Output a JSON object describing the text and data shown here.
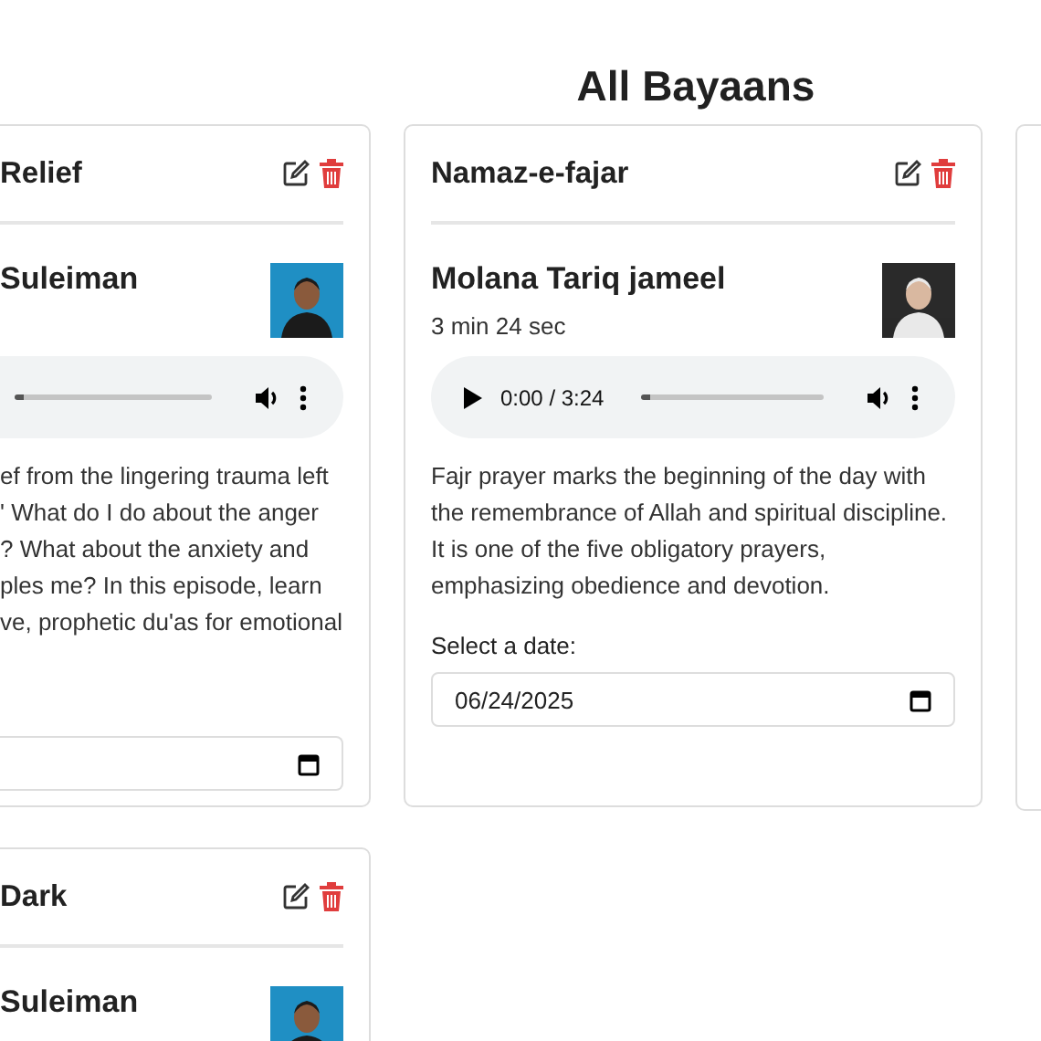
{
  "page_title": "All Bayaans",
  "cards": [
    {
      "kind": "clipped",
      "title": "Relief",
      "speaker": "Suleiman",
      "photo": {
        "kind": "picture"
      },
      "audio": {
        "kind": "player"
      },
      "description_lines": [
        "ef from the lingering trauma left",
        "' What do I do about the anger",
        "? What about the anxiety and",
        "ples me? In this episode, learn",
        "ve, prophetic du'as for emotional"
      ],
      "date_field": {
        "kind": "date"
      }
    },
    {
      "kind": "full",
      "title": "Namaz-e-fajar",
      "speaker": "Molana Tariq jameel",
      "duration": "3 min 24 sec",
      "photo": {
        "kind": "picture"
      },
      "audio": {
        "kind": "player",
        "time": "0:00 / 3:24"
      },
      "description_lines": [
        "Fajr prayer marks the beginning of the day with",
        "the remembrance of Allah and spiritual discipline.",
        "It is one of the five obligatory prayers,",
        "emphasizing obedience and devotion."
      ],
      "date_label": "Select a date:",
      "date_field": {
        "kind": "date",
        "value": "06/24/2025"
      }
    },
    {
      "kind": "edge"
    },
    {
      "kind": "clipped",
      "title": "Dark",
      "speaker": "Suleiman",
      "photo": {
        "kind": "picture"
      }
    }
  ]
}
